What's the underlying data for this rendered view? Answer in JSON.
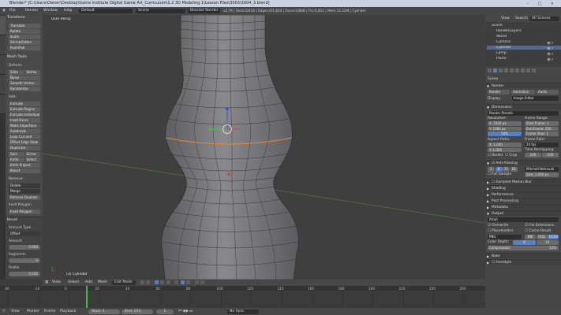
{
  "window": {
    "title": "Blender* [C:\\Users\\Owner\\Desktop\\Game Institute Digital Game Art_Curriculum\\1.2 3D Modeling 1\\Lesson Files\\3003\\3004_3.blend]"
  },
  "menu": {
    "items": [
      "File",
      "Render",
      "Window",
      "Help"
    ],
    "layout": "Default",
    "scene": "Scene",
    "engine": "Blender Render",
    "stats": "v2.76 | Verts:0/416 | Edges:0/1,824 | Faces:0/808 | Tris:0,812 | Mem:12.22M | Cylinder"
  },
  "toolshelf": {
    "tabs": [
      "Tools",
      "Create",
      "Shading / UVs",
      "Options",
      "Grease Pencil"
    ],
    "transform_header": "Transform",
    "transform": [
      "Translate",
      "Rotate",
      "Scale",
      "Shrink/Fatten",
      "Push/Pull"
    ],
    "meshtools_header": "Mesh Tools",
    "deform_label": "Deform:",
    "deform": [
      "Slide Edge",
      "Vertex",
      "Noise",
      "Smooth Vertex",
      "Randomize"
    ],
    "add_label": "Add:",
    "add": [
      "Extrude",
      "Extrude Region",
      "Extrude Individual",
      "Inset Faces",
      "Make Edge/Face",
      "Subdivide",
      "Loop Cut and Slide",
      "Offset Edge Slide",
      "Duplicate"
    ],
    "spin": "Spin",
    "screw": "Screw",
    "knife": "Knife",
    "select": "Select",
    "knife_project": "Knife Project",
    "bisect": "Bisect",
    "remove_label": "Remove:",
    "remove": [
      "Delete",
      "Merge",
      "Remove Doubles"
    ],
    "inset_label": "Inset Polygon",
    "inset_btn": "Inset Polygon",
    "bevel_header": "Bevel",
    "amount_type_label": "Amount Type",
    "amount_type": "Offset",
    "amount_label": "Amount",
    "amount_value": "0.069",
    "segments_label": "Segments",
    "segments_value": "4",
    "profile_label": "Profile",
    "profile_value": "0.500"
  },
  "viewport": {
    "label": "User Persp",
    "object_label": "(3) Cylinder"
  },
  "viewport_header": {
    "items": [
      "View",
      "Select",
      "Add",
      "Mesh"
    ],
    "mode": "Edit Mode"
  },
  "timeline": {
    "ticks": [
      "-40",
      "-20",
      "0",
      "20",
      "40",
      "60",
      "80",
      "100",
      "120",
      "140",
      "160",
      "180",
      "200",
      "220",
      "240",
      "260"
    ]
  },
  "timeline_bar": {
    "items": [
      "View",
      "Marker",
      "Frame",
      "Playback"
    ],
    "start": "Start:",
    "start_value": "1",
    "end": "End:",
    "end_value": "250",
    "current": "1",
    "sync": "No Sync"
  },
  "outliner": {
    "header_items": [
      "View",
      "Search",
      "All Scenes"
    ],
    "tree": [
      "Scene",
      "RenderLayers",
      "World",
      "Camera",
      "Cylinder",
      "Lamp",
      "Plane"
    ]
  },
  "properties": {
    "scene_label": "Scene",
    "render_header": "Render",
    "render_btns": [
      "Render",
      "Animation",
      "Audio"
    ],
    "display_label": "Display:",
    "display_value": "Image Editor",
    "dimensions_header": "Dimensions",
    "preset": "Render Presets",
    "resolution_label": "Resolution:",
    "res_x": "X: 1920 px",
    "res_y": "Y: 1080 px",
    "res_pct": "50%",
    "frame_range_label": "Frame Range:",
    "start_frame": "Start Frame: 1",
    "end_frame": "End Frame: 250",
    "frame_step": "Frame Step: 1",
    "aspect_label": "Aspect Ratio:",
    "aspect_x": "X: 1.000",
    "aspect_y": "Y: 1.000",
    "frame_rate_label": "Frame Rate:",
    "frame_rate": "24 fps",
    "time_remap_label": "Time Remapping:",
    "remap_old": "100",
    "remap_new": "100",
    "border": "Border",
    "crop": "Crop",
    "antialias_header": "Anti-Aliasing",
    "aa_levels": [
      "5",
      "8",
      "11",
      "16"
    ],
    "aa_filter": "Mitchell-Netravali",
    "full_sample": "Full Sample",
    "size_value": "Size: 1.000 px",
    "sections_mid": [
      "Sampled Motion Blur",
      "Shading",
      "Performance",
      "Post Processing",
      "Metadata"
    ],
    "output_header": "Output",
    "output_path": "/tmp\\",
    "overwrite": "Overwrite",
    "file_ext": "File Extensions",
    "placeholders": "Placeholders",
    "cache_result": "Cache Result",
    "format": "PNG",
    "color_modes": [
      "BW",
      "RGB",
      "RGBA"
    ],
    "color_depth_label": "Color Depth:",
    "color_depth": [
      "8",
      "16"
    ],
    "compression": "Compression:",
    "compression_value": "15%",
    "sections_end": [
      "Bake",
      "Freestyle"
    ]
  },
  "colors": {
    "accent": "#5680c2",
    "selection": "#e08b3a"
  }
}
